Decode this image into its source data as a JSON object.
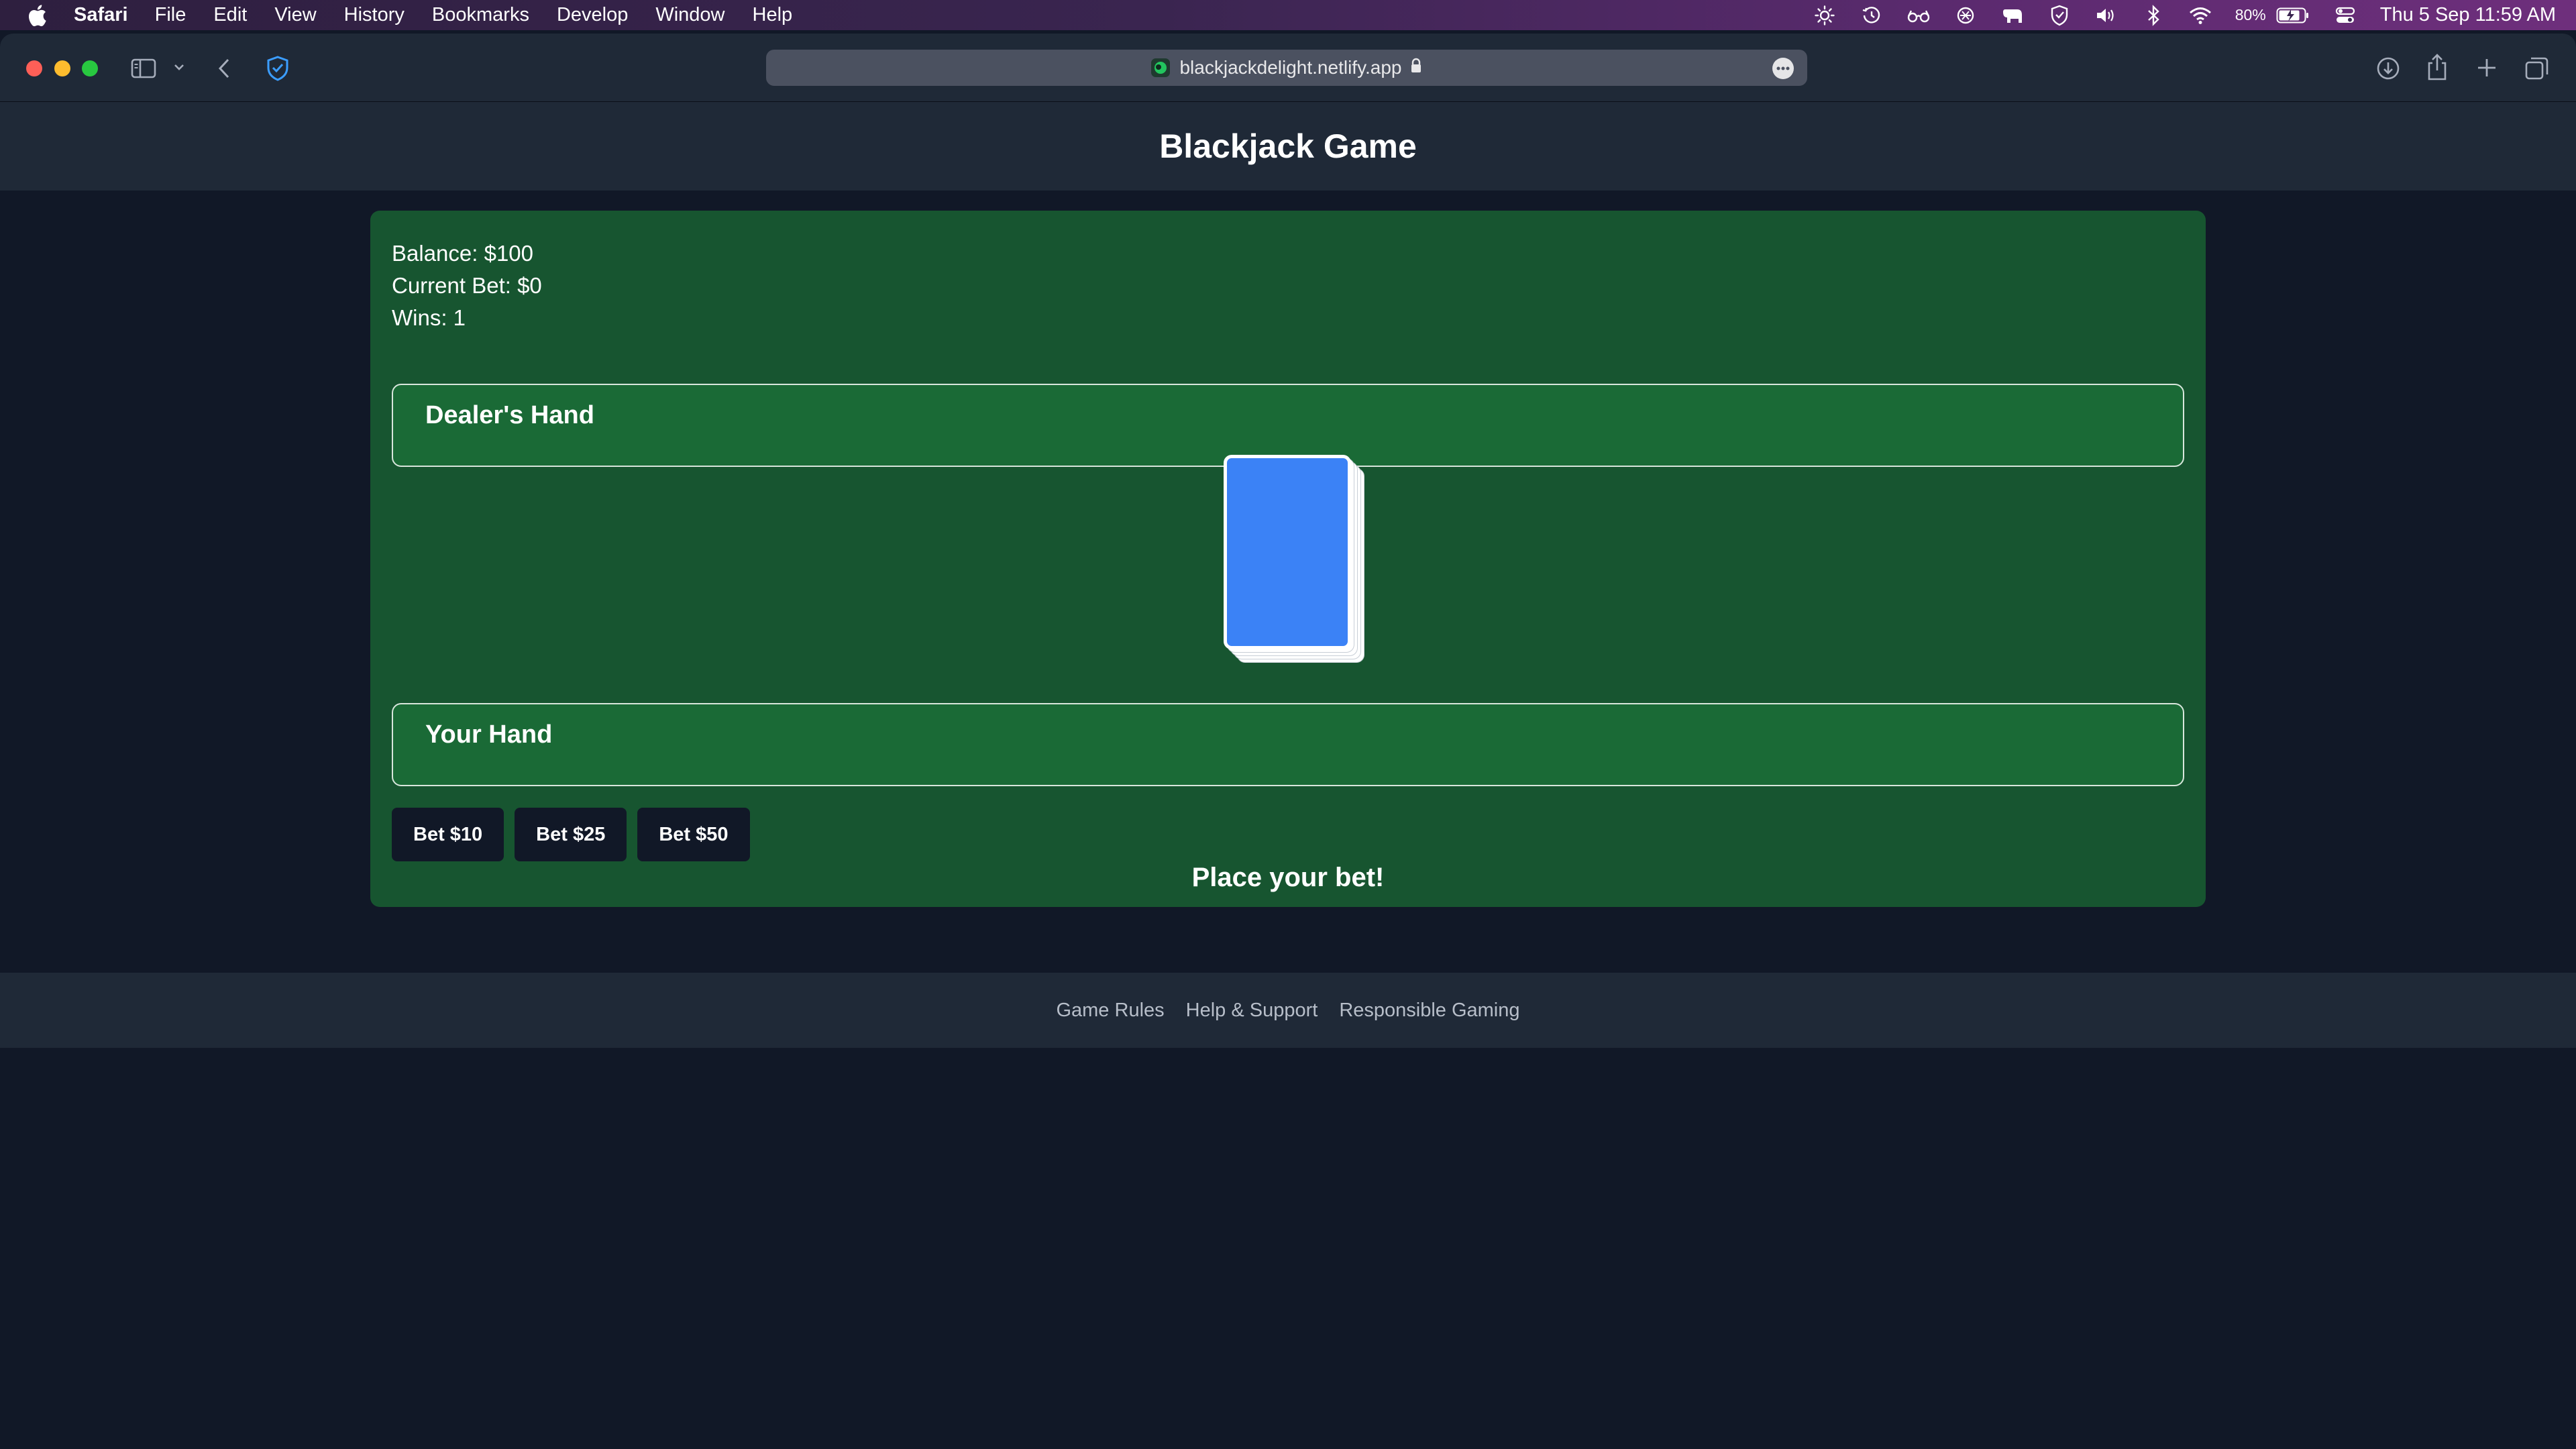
{
  "menubar": {
    "app_name": "Safari",
    "items": [
      "File",
      "Edit",
      "View",
      "History",
      "Bookmarks",
      "Develop",
      "Window",
      "Help"
    ],
    "battery_percent": "80%",
    "datetime": "Thu 5 Sep  11:59 AM"
  },
  "browser": {
    "url": "blackjackdelight.netlify.app"
  },
  "page": {
    "title": "Blackjack Game",
    "stats": {
      "balance": "Balance: $100",
      "current_bet": "Current Bet: $0",
      "wins": "Wins: 1"
    },
    "dealer_hand_label": "Dealer's Hand",
    "player_hand_label": "Your Hand",
    "bet_buttons": [
      "Bet $10",
      "Bet $25",
      "Bet $50"
    ],
    "message": "Place your bet!"
  },
  "footer": {
    "links": [
      "Game Rules",
      "Help & Support",
      "Responsible Gaming"
    ]
  },
  "colors": {
    "table_green": "#175530",
    "hand_green": "#1a6a36",
    "card_back_blue": "#3b82f6",
    "button_dark": "#111827",
    "header_bg": "#1f2937"
  }
}
